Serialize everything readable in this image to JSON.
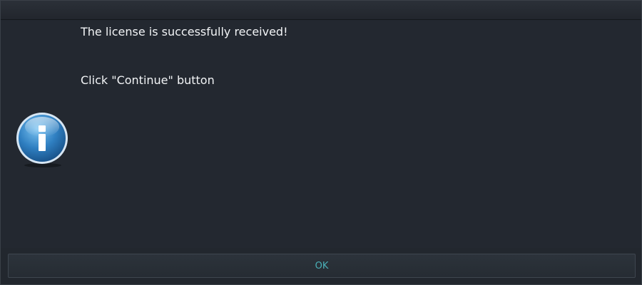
{
  "message": {
    "line1": "The license is successfully received!",
    "line2": "Click \"Continue\" button"
  },
  "icon": {
    "name": "info-icon",
    "glyph": "i",
    "color": "#2f7fc1"
  },
  "buttons": {
    "ok_label": "OK"
  },
  "colors": {
    "background": "#232830",
    "text": "#f2f4f6",
    "button_text": "#4ab0b8"
  }
}
